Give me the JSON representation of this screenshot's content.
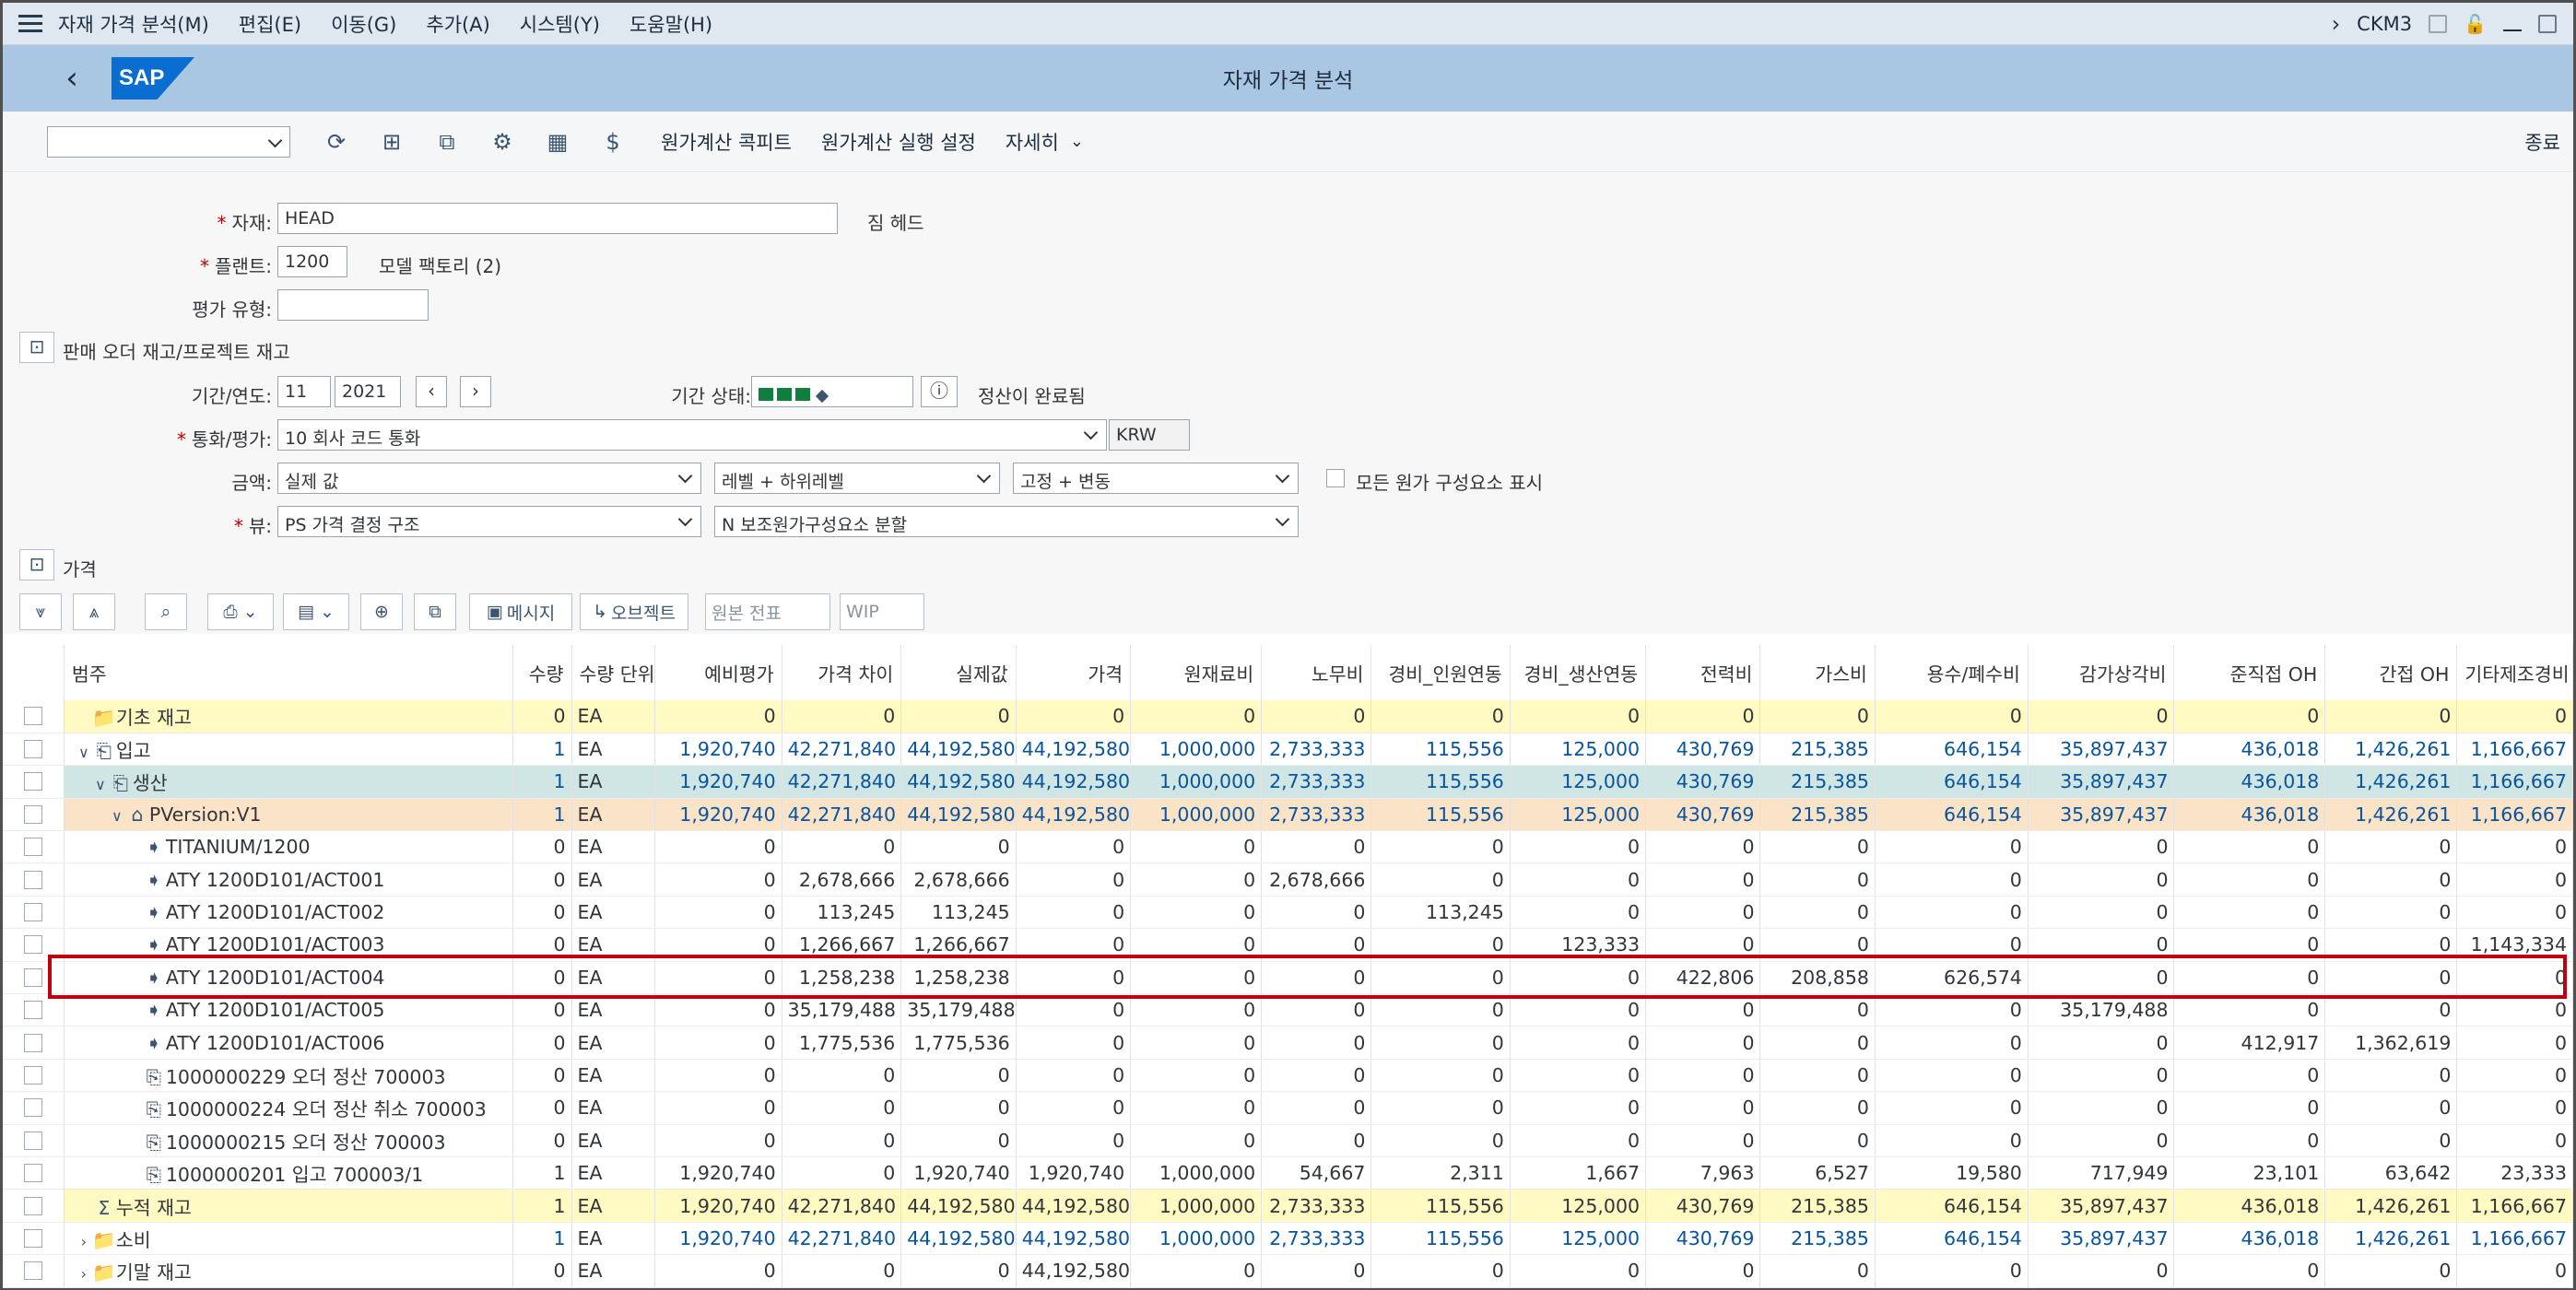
{
  "menubar": {
    "items": [
      "자재 가격 분석(M)",
      "편집(E)",
      "이동(G)",
      "추가(A)",
      "시스템(Y)",
      "도움말(H)"
    ],
    "tcode": "CKM3"
  },
  "titlebar": {
    "back": "‹",
    "logo": "SAP",
    "title": "자재 가격 분석"
  },
  "toolbar": {
    "links": [
      "원가계산 콕피트",
      "원가계산 실행 설정",
      "자세히"
    ],
    "exit": "종료"
  },
  "form": {
    "material_label": "자재:",
    "material_value": "HEAD",
    "material_desc": "짐 헤드",
    "plant_label": "플랜트:",
    "plant_value": "1200",
    "plant_desc": "모델 팩토리 (2)",
    "valtype_label": "평가 유형:",
    "sales_order_label": "판매 오더 재고/프로젝트 재고",
    "period_label": "기간/연도:",
    "period_value": "11",
    "year_value": "2021",
    "period_status_label": "기간 상태:",
    "period_status_text": "정산이 완료됨",
    "currency_label": "통화/평가:",
    "currency_value": "10 회사 코드 통화",
    "currency_code": "KRW",
    "amount_label": "금액:",
    "amount_value": "실제 값",
    "level_value": "레벨 + 하위레벨",
    "fixvar_value": "고정 + 변동",
    "show_all_label": "모든 원가 구성요소 표시",
    "view_label": "뷰:",
    "view_value": "PS 가격 결정 구조",
    "split_value": "N 보조원가구성요소 분할",
    "price_section": "가격"
  },
  "alv": {
    "message": "메시지",
    "object": "오브젝트",
    "source_doc": "원본 전표",
    "wip": "WIP"
  },
  "table": {
    "headers": [
      "범주",
      "수량",
      "수량 단위",
      "예비평가",
      "가격 차이",
      "실제값",
      "가격",
      "원재료비",
      "노무비",
      "경비_인원연동",
      "경비_생산연동",
      "전력비",
      "가스비",
      "용수/폐수비",
      "감가상각비",
      "준직접 OH",
      "간접 OH",
      "기타제조경비"
    ],
    "rows": [
      {
        "label": "기초 재고",
        "style": "yellow",
        "level": 0,
        "chev": "",
        "icon": "📁",
        "vals": [
          "0",
          "EA",
          "0",
          "0",
          "0",
          "0",
          "0",
          "0",
          "0",
          "0",
          "0",
          "0",
          "0",
          "0",
          "0",
          "0",
          "0"
        ]
      },
      {
        "label": "입고",
        "style": "blue",
        "level": 0,
        "chev": "∨",
        "icon": "⎗",
        "vals": [
          "1",
          "EA",
          "1,920,740",
          "42,271,840",
          "44,192,580",
          "44,192,580",
          "1,000,000",
          "2,733,333",
          "115,556",
          "125,000",
          "430,769",
          "215,385",
          "646,154",
          "35,897,437",
          "436,018",
          "1,426,261",
          "1,166,667"
        ]
      },
      {
        "label": "생산",
        "style": "teal blue",
        "level": 1,
        "chev": "∨",
        "icon": "⎗",
        "vals": [
          "1",
          "EA",
          "1,920,740",
          "42,271,840",
          "44,192,580",
          "44,192,580",
          "1,000,000",
          "2,733,333",
          "115,556",
          "125,000",
          "430,769",
          "215,385",
          "646,154",
          "35,897,437",
          "436,018",
          "1,426,261",
          "1,166,667"
        ]
      },
      {
        "label": "PVersion:V1",
        "style": "orange blue",
        "level": 2,
        "chev": "∨",
        "icon": "⌂",
        "vals": [
          "1",
          "EA",
          "1,920,740",
          "42,271,840",
          "44,192,580",
          "44,192,580",
          "1,000,000",
          "2,733,333",
          "115,556",
          "125,000",
          "430,769",
          "215,385",
          "646,154",
          "35,897,437",
          "436,018",
          "1,426,261",
          "1,166,667"
        ]
      },
      {
        "label": "TITANIUM/1200",
        "style": "",
        "level": 3,
        "chev": "",
        "icon": "➧",
        "vals": [
          "0",
          "EA",
          "0",
          "0",
          "0",
          "0",
          "0",
          "0",
          "0",
          "0",
          "0",
          "0",
          "0",
          "0",
          "0",
          "0",
          "0"
        ]
      },
      {
        "label": "ATY 1200D101/ACT001",
        "style": "",
        "level": 3,
        "chev": "",
        "icon": "➧",
        "vals": [
          "0",
          "EA",
          "0",
          "2,678,666",
          "2,678,666",
          "0",
          "0",
          "2,678,666",
          "0",
          "0",
          "0",
          "0",
          "0",
          "0",
          "0",
          "0",
          "0"
        ]
      },
      {
        "label": "ATY 1200D101/ACT002",
        "style": "",
        "level": 3,
        "chev": "",
        "icon": "➧",
        "vals": [
          "0",
          "EA",
          "0",
          "113,245",
          "113,245",
          "0",
          "0",
          "0",
          "113,245",
          "0",
          "0",
          "0",
          "0",
          "0",
          "0",
          "0",
          "0"
        ]
      },
      {
        "label": "ATY 1200D101/ACT003",
        "style": "",
        "level": 3,
        "chev": "",
        "icon": "➧",
        "vals": [
          "0",
          "EA",
          "0",
          "1,266,667",
          "1,266,667",
          "0",
          "0",
          "0",
          "0",
          "123,333",
          "0",
          "0",
          "0",
          "0",
          "0",
          "0",
          "1,143,334"
        ]
      },
      {
        "label": "ATY 1200D101/ACT004",
        "style": "",
        "level": 3,
        "chev": "",
        "icon": "➧",
        "vals": [
          "0",
          "EA",
          "0",
          "1,258,238",
          "1,258,238",
          "0",
          "0",
          "0",
          "0",
          "0",
          "422,806",
          "208,858",
          "626,574",
          "0",
          "0",
          "0",
          "0"
        ]
      },
      {
        "label": "ATY 1200D101/ACT005",
        "style": "",
        "level": 3,
        "chev": "",
        "icon": "➧",
        "vals": [
          "0",
          "EA",
          "0",
          "35,179,488",
          "35,179,488",
          "0",
          "0",
          "0",
          "0",
          "0",
          "0",
          "0",
          "0",
          "35,179,488",
          "0",
          "0",
          "0"
        ]
      },
      {
        "label": "ATY 1200D101/ACT006",
        "style": "",
        "level": 3,
        "chev": "",
        "icon": "➧",
        "vals": [
          "0",
          "EA",
          "0",
          "1,775,536",
          "1,775,536",
          "0",
          "0",
          "0",
          "0",
          "0",
          "0",
          "0",
          "0",
          "0",
          "412,917",
          "1,362,619",
          "0"
        ]
      },
      {
        "label": "1000000229 오더 정산 700003",
        "style": "",
        "level": 3,
        "chev": "",
        "icon": "⎘",
        "vals": [
          "0",
          "EA",
          "0",
          "0",
          "0",
          "0",
          "0",
          "0",
          "0",
          "0",
          "0",
          "0",
          "0",
          "0",
          "0",
          "0",
          "0"
        ]
      },
      {
        "label": "1000000224 오더 정산 취소 700003",
        "style": "",
        "level": 3,
        "chev": "",
        "icon": "⎘",
        "vals": [
          "0",
          "EA",
          "0",
          "0",
          "0",
          "0",
          "0",
          "0",
          "0",
          "0",
          "0",
          "0",
          "0",
          "0",
          "0",
          "0",
          "0"
        ]
      },
      {
        "label": "1000000215 오더 정산 700003",
        "style": "",
        "level": 3,
        "chev": "",
        "icon": "⎘",
        "vals": [
          "0",
          "EA",
          "0",
          "0",
          "0",
          "0",
          "0",
          "0",
          "0",
          "0",
          "0",
          "0",
          "0",
          "0",
          "0",
          "0",
          "0"
        ]
      },
      {
        "label": "1000000201 입고 700003/1",
        "style": "",
        "level": 3,
        "chev": "",
        "icon": "⎘",
        "vals": [
          "1",
          "EA",
          "1,920,740",
          "0",
          "1,920,740",
          "1,920,740",
          "1,000,000",
          "54,667",
          "2,311",
          "1,667",
          "7,963",
          "6,527",
          "19,580",
          "717,949",
          "23,101",
          "63,642",
          "23,333"
        ]
      },
      {
        "label": "누적 재고",
        "style": "yellow",
        "level": 0,
        "chev": "",
        "icon": "Σ",
        "vals": [
          "1",
          "EA",
          "1,920,740",
          "42,271,840",
          "44,192,580",
          "44,192,580",
          "1,000,000",
          "2,733,333",
          "115,556",
          "125,000",
          "430,769",
          "215,385",
          "646,154",
          "35,897,437",
          "436,018",
          "1,426,261",
          "1,166,667"
        ]
      },
      {
        "label": "소비",
        "style": "blue",
        "level": 0,
        "chev": "›",
        "icon": "📁",
        "vals": [
          "1",
          "EA",
          "1,920,740",
          "42,271,840",
          "44,192,580",
          "44,192,580",
          "1,000,000",
          "2,733,333",
          "115,556",
          "125,000",
          "430,769",
          "215,385",
          "646,154",
          "35,897,437",
          "436,018",
          "1,426,261",
          "1,166,667"
        ]
      },
      {
        "label": "기말 재고",
        "style": "",
        "level": 0,
        "chev": "›",
        "icon": "📁",
        "vals": [
          "0",
          "EA",
          "0",
          "0",
          "0",
          "44,192,580",
          "0",
          "0",
          "0",
          "0",
          "0",
          "0",
          "0",
          "0",
          "0",
          "0",
          "0"
        ]
      }
    ]
  }
}
